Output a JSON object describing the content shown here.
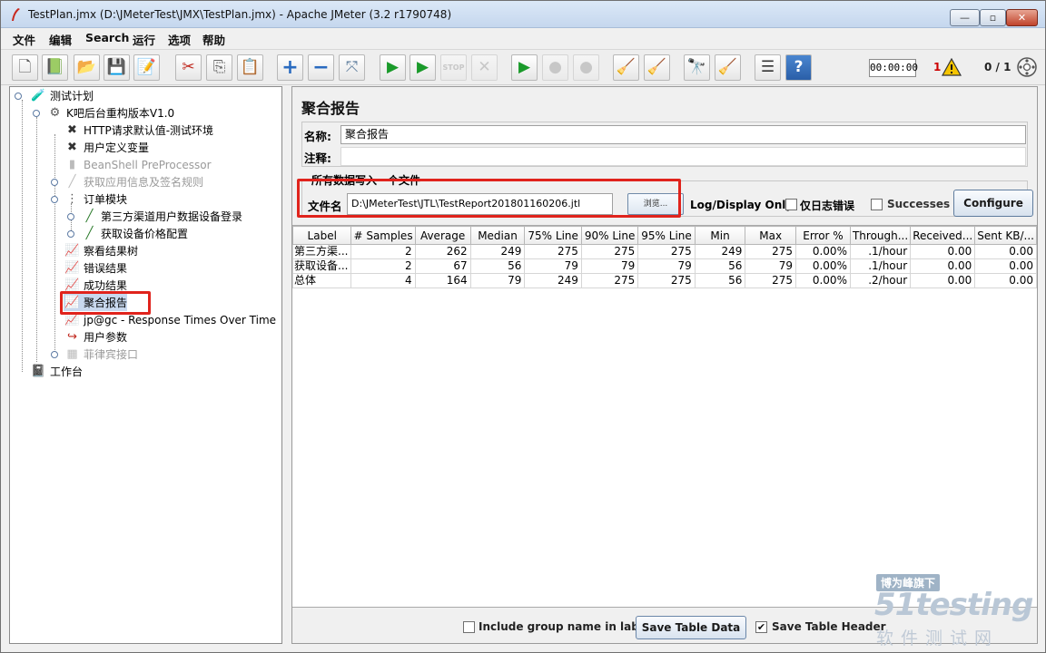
{
  "window": {
    "title": "TestPlan.jmx (D:\\JMeterTest\\JMX\\TestPlan.jmx) - Apache JMeter (3.2 r1790748)",
    "min_label": "—",
    "max_label": "▫",
    "close_label": "✕"
  },
  "menu": [
    "文件",
    "编辑",
    "Search",
    "运行",
    "选项",
    "帮助"
  ],
  "toolbar": {
    "buttons": [
      {
        "icon": "new-icon",
        "glyph": "🗋"
      },
      {
        "icon": "templates-icon",
        "glyph": "📗"
      },
      {
        "icon": "open-icon",
        "glyph": "📂"
      },
      {
        "icon": "save-icon",
        "glyph": "💾"
      },
      {
        "icon": "save-as-icon",
        "glyph": "📝"
      },
      {
        "icon": "cut-icon",
        "glyph": "✂"
      },
      {
        "icon": "copy-icon",
        "glyph": "⎘"
      },
      {
        "icon": "paste-icon",
        "glyph": "📋"
      },
      {
        "icon": "expand-icon",
        "glyph": "+"
      },
      {
        "icon": "collapse-icon",
        "glyph": "−"
      },
      {
        "icon": "toggle-icon",
        "glyph": "⤧"
      },
      {
        "icon": "start-icon",
        "glyph": "▶"
      },
      {
        "icon": "start-no-pause-icon",
        "glyph": "▶"
      },
      {
        "icon": "stop-icon",
        "glyph": "STOP"
      },
      {
        "icon": "shutdown-icon",
        "glyph": "✕"
      },
      {
        "icon": "remote-start-icon",
        "glyph": "▶"
      },
      {
        "icon": "remote-stop-icon",
        "glyph": "●"
      },
      {
        "icon": "remote-shutdown-icon",
        "glyph": "●"
      },
      {
        "icon": "clear-icon",
        "glyph": "🧹"
      },
      {
        "icon": "clear-all-icon",
        "glyph": "🧹"
      },
      {
        "icon": "search-icon",
        "glyph": "🔭"
      },
      {
        "icon": "reset-search-icon",
        "glyph": "🧹"
      },
      {
        "icon": "function-helper-icon",
        "glyph": "☰"
      },
      {
        "icon": "help-icon",
        "glyph": "?"
      }
    ],
    "timer": "00:00:00",
    "error_count": "1",
    "threads": "0 / 1"
  },
  "tree": {
    "nodes": [
      {
        "label": "测试计划",
        "icon": "flask-icon",
        "glyph": "🧪",
        "disabled": false
      },
      {
        "label": "K吧后台重构版本V1.0",
        "icon": "gear-icon",
        "glyph": "⚙",
        "disabled": false
      },
      {
        "label": "HTTP请求默认值-测试环境",
        "icon": "wrench-icon",
        "glyph": "✖",
        "disabled": false
      },
      {
        "label": "用户定义变量",
        "icon": "wrench-icon",
        "glyph": "✖",
        "disabled": false
      },
      {
        "label": "BeanShell PreProcessor",
        "icon": "preprocessor-icon",
        "glyph": "▮",
        "disabled": true
      },
      {
        "label": "获取应用信息及签名规则",
        "icon": "sampler-icon",
        "glyph": "╱",
        "disabled": true
      },
      {
        "label": "订单模块",
        "icon": "controller-icon",
        "glyph": "⋮",
        "disabled": false
      },
      {
        "label": "第三方渠道用户数据设备登录",
        "icon": "pipette-icon",
        "glyph": "╱",
        "disabled": false
      },
      {
        "label": "获取设备价格配置",
        "icon": "pipette-icon",
        "glyph": "╱",
        "disabled": false
      },
      {
        "label": "察看结果树",
        "icon": "listener-icon",
        "glyph": "📈",
        "disabled": false
      },
      {
        "label": "错误结果",
        "icon": "listener-icon",
        "glyph": "📈",
        "disabled": false
      },
      {
        "label": "成功结果",
        "icon": "listener-icon",
        "glyph": "📈",
        "disabled": false
      },
      {
        "label": "聚合报告",
        "icon": "listener-icon",
        "glyph": "📈",
        "disabled": false
      },
      {
        "label": "jp@gc - Response Times Over Time",
        "icon": "listener-icon",
        "glyph": "📈",
        "disabled": false
      },
      {
        "label": "用户参数",
        "icon": "user-params-icon",
        "glyph": "↪",
        "disabled": false
      },
      {
        "label": "菲律宾接口",
        "icon": "controller-icon",
        "glyph": "▦",
        "disabled": true
      },
      {
        "label": "工作台",
        "icon": "workbench-icon",
        "glyph": "📓",
        "disabled": false
      }
    ]
  },
  "panel": {
    "title": "聚合报告",
    "name_label": "名称:",
    "name_value": "聚合报告",
    "comment_label": "注释:",
    "comment_value": "",
    "file_group_legend": "所有数据写入一个文件",
    "filename_label": "文件名",
    "filename_value": "D:\\JMeterTest\\JTL\\TestReport201801160206.jtl",
    "browse_label": "浏览...",
    "log_display_label": "Log/Display Only:",
    "errors_only_label": "仅日志错误",
    "successes_label": "Successes",
    "configure_label": "Configure"
  },
  "table": {
    "headers": [
      "Label",
      "# Samples",
      "Average",
      "Median",
      "75% Line",
      "90% Line",
      "95% Line",
      "Min",
      "Max",
      "Error %",
      "Through...",
      "Received...",
      "Sent KB/..."
    ],
    "rows": [
      [
        "第三方渠...",
        "2",
        "262",
        "249",
        "275",
        "275",
        "275",
        "249",
        "275",
        "0.00%",
        ".1/hour",
        "0.00",
        "0.00"
      ],
      [
        "获取设备...",
        "2",
        "67",
        "56",
        "79",
        "79",
        "79",
        "56",
        "79",
        "0.00%",
        ".1/hour",
        "0.00",
        "0.00"
      ],
      [
        "总体",
        "4",
        "164",
        "79",
        "249",
        "275",
        "275",
        "56",
        "275",
        "0.00%",
        ".2/hour",
        "0.00",
        "0.00"
      ]
    ]
  },
  "bottom": {
    "group_name_label": "Include group name in label?",
    "group_name_checked": false,
    "save_table_label": "Save Table Data",
    "save_header_label": "Save Table Header",
    "save_header_checked": true
  },
  "watermark": {
    "top": "博为峰旗下",
    "logo": "51testing",
    "bottom": "软件测试网"
  },
  "colors": {
    "highlight_red": "#e0231c",
    "start_green": "#1a9a2a",
    "titlebar": "#c5d7ee"
  }
}
